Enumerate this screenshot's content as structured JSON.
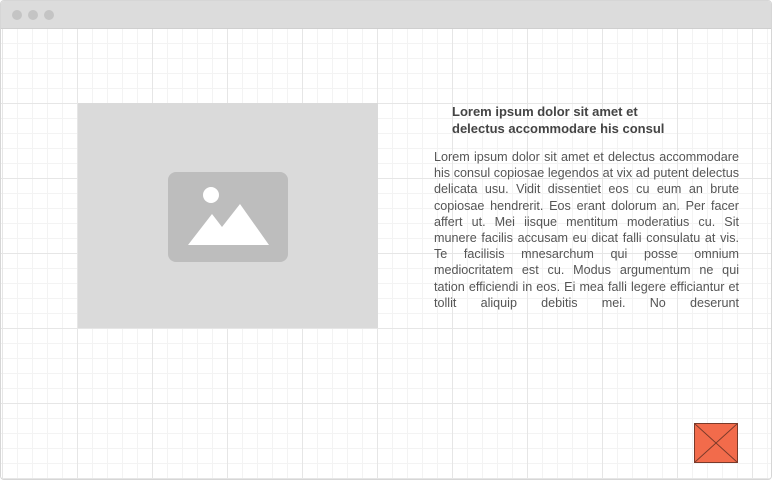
{
  "window": {
    "controls": [
      "window-dot-1",
      "window-dot-2",
      "window-dot-3"
    ]
  },
  "content": {
    "headline_line1": "Lorem ipsum dolor sit amet et",
    "headline_line2": "delectus accommodare his consul",
    "body": "Lorem ipsum dolor sit amet et delectus accommodare his consul copiosae legendos at vix ad putent delectus delicata usu. Vidit dissentiet eos cu eum an brute copiosae hendrerit. Eos erant dolorum an. Per facer affert ut. Mei iisque mentitum moderatius cu. Sit munere facilis accusam eu dicat falli consulatu at vis. Te facilisis mnesarchum qui posse omnium mediocritatem est cu. Modus argumentum ne qui tation efficiendi in eos. Ei mea falli legere efficiantur et tollit aliquip debitis mei. No deserunt"
  },
  "image": {
    "icon": "image-icon"
  },
  "close": {
    "icon": "x-icon",
    "color": "#f26b4b"
  },
  "colors": {
    "titlebar": "#dcdcdc",
    "placeholder": "#dadada",
    "placeholder_icon": "#bdbdbd",
    "grid": "#e6e6e6"
  }
}
